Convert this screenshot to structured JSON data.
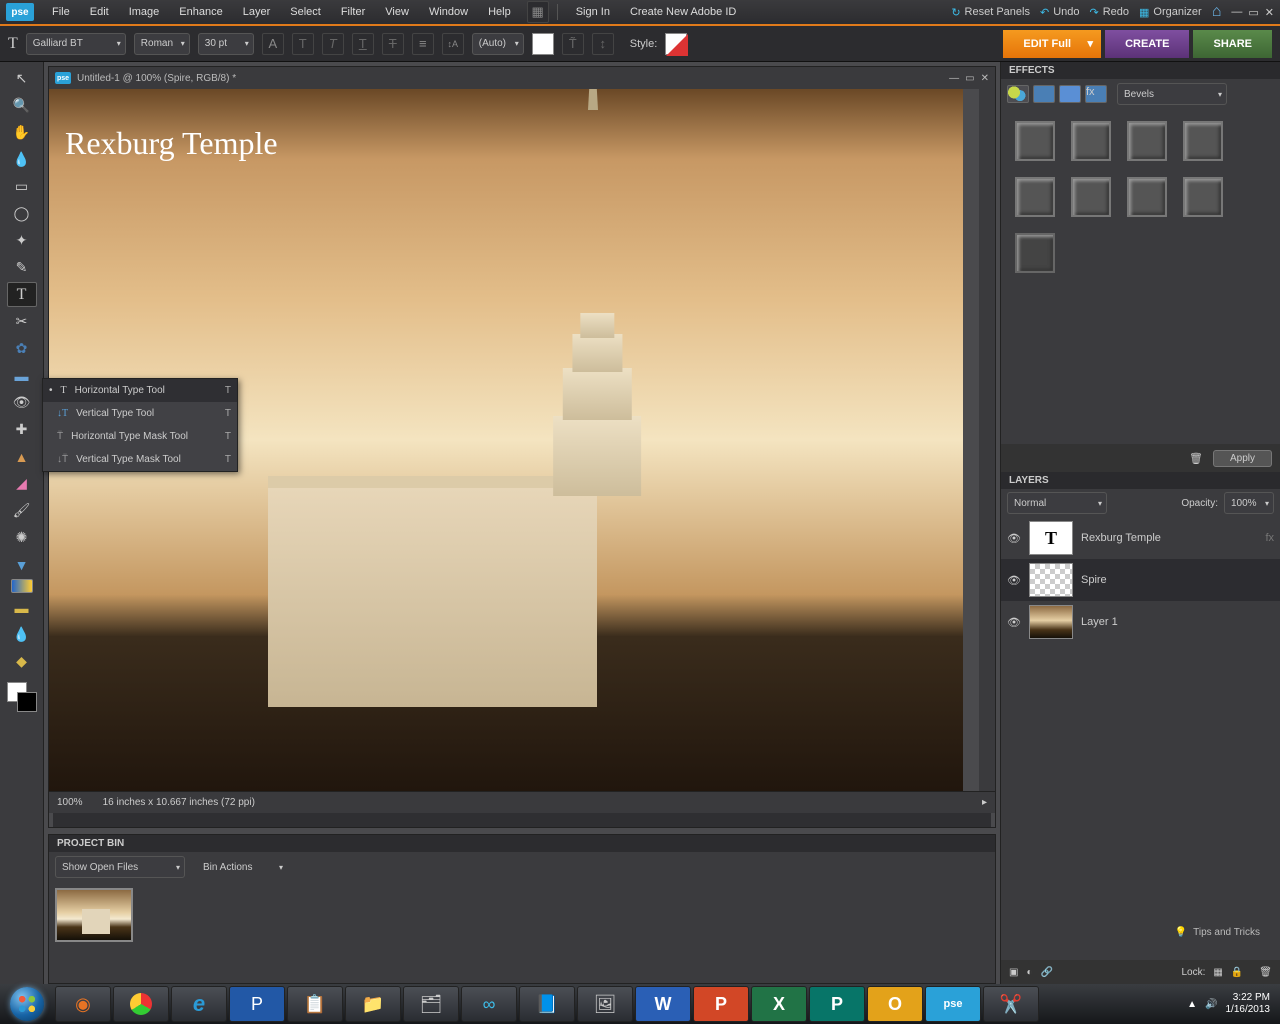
{
  "app_logo": "pse",
  "menu": [
    "File",
    "Edit",
    "Image",
    "Enhance",
    "Layer",
    "Select",
    "Filter",
    "View",
    "Window",
    "Help"
  ],
  "account": {
    "signin": "Sign In",
    "create": "Create New Adobe ID"
  },
  "top_right": {
    "reset": "Reset Panels",
    "undo": "Undo",
    "redo": "Redo",
    "organizer": "Organizer"
  },
  "options": {
    "font": "Galliard BT",
    "style": "Roman",
    "size": "30 pt",
    "leading": "(Auto)",
    "style_label": "Style:"
  },
  "big_buttons": {
    "edit": "EDIT Full",
    "create": "CREATE",
    "share": "SHARE"
  },
  "doc_title": "Untitled-1 @ 100% (Spire, RGB/8) *",
  "canvas_text": "Rexburg Temple",
  "status": {
    "zoom": "100%",
    "dims": "16 inches x 10.667 inches (72 ppi)"
  },
  "flyout": [
    {
      "label": "Horizontal Type Tool",
      "key": "T",
      "sel": true
    },
    {
      "label": "Vertical Type Tool",
      "key": "T"
    },
    {
      "label": "Horizontal Type Mask Tool",
      "key": "T"
    },
    {
      "label": "Vertical Type Mask Tool",
      "key": "T"
    }
  ],
  "bin": {
    "title": "PROJECT BIN",
    "show": "Show Open Files",
    "actions": "Bin Actions"
  },
  "effects": {
    "title": "EFFECTS",
    "dropdown": "Bevels",
    "apply": "Apply"
  },
  "layers": {
    "title": "LAYERS",
    "blend": "Normal",
    "opacity_label": "Opacity:",
    "opacity": "100%",
    "lock": "Lock:",
    "items": [
      {
        "name": "Rexburg Temple",
        "type": "text"
      },
      {
        "name": "Spire",
        "type": "checker",
        "sel": true
      },
      {
        "name": "Layer 1",
        "type": "img"
      }
    ]
  },
  "tips": "Tips and Tricks",
  "clock": {
    "time": "3:22 PM",
    "date": "1/16/2013"
  }
}
